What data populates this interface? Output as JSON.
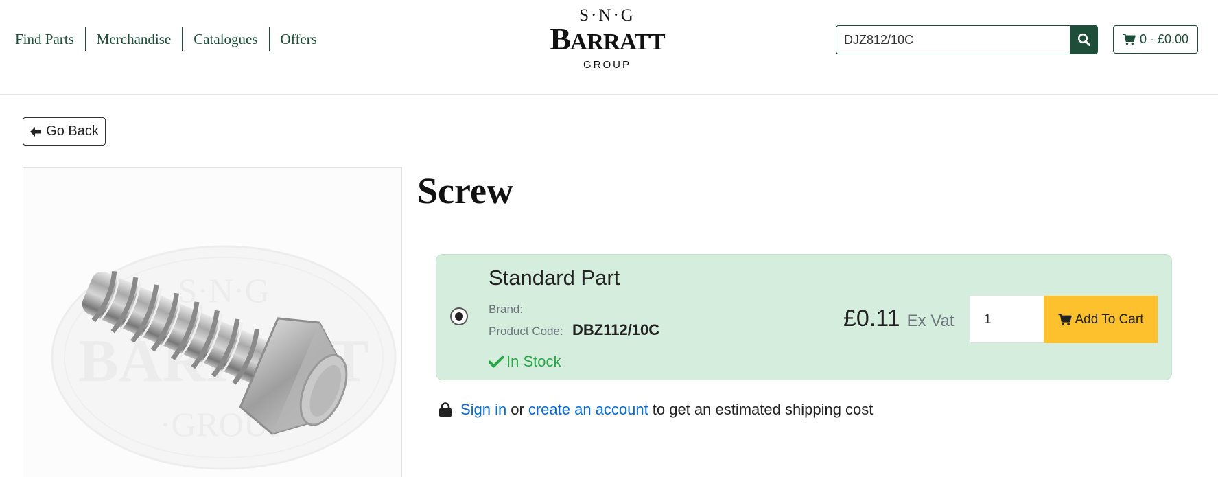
{
  "nav": {
    "items": [
      {
        "label": "Find Parts"
      },
      {
        "label": "Merchandise"
      },
      {
        "label": "Catalogues"
      },
      {
        "label": "Offers"
      }
    ]
  },
  "logo": {
    "top": "S·N·G",
    "main_first": "B",
    "main_small": "ARRATT",
    "bottom": "GROUP"
  },
  "search": {
    "value": "DJZ812/10C",
    "icon": "search-icon"
  },
  "cart": {
    "label": "0 - £0.00",
    "icon": "cart-icon"
  },
  "back": {
    "label": "Go Back",
    "icon": "arrow-left-icon"
  },
  "product": {
    "title": "Screw",
    "image_watermark": [
      "S·N·G",
      "BARRATT",
      "·GROUP"
    ]
  },
  "part": {
    "type": "Standard Part",
    "brand_label": "Brand:",
    "brand_value": "",
    "code_label": "Product Code:",
    "code_value": "DBZ112/10C",
    "stock": "In Stock",
    "price": "£0.11",
    "price_suffix": "Ex Vat",
    "quantity": "1",
    "add_label": "Add To Cart",
    "selected": true
  },
  "shipping": {
    "sign_in": "Sign in",
    "or": "or",
    "create": "create an account",
    "rest": "to get an estimated shipping cost",
    "icon": "lock-icon"
  },
  "colors": {
    "brand_green": "#1e4d3a",
    "card_green": "#d4eddc",
    "stock_green": "#28a745",
    "cart_yellow": "#fec12e",
    "link_blue": "#0b6bd3"
  }
}
